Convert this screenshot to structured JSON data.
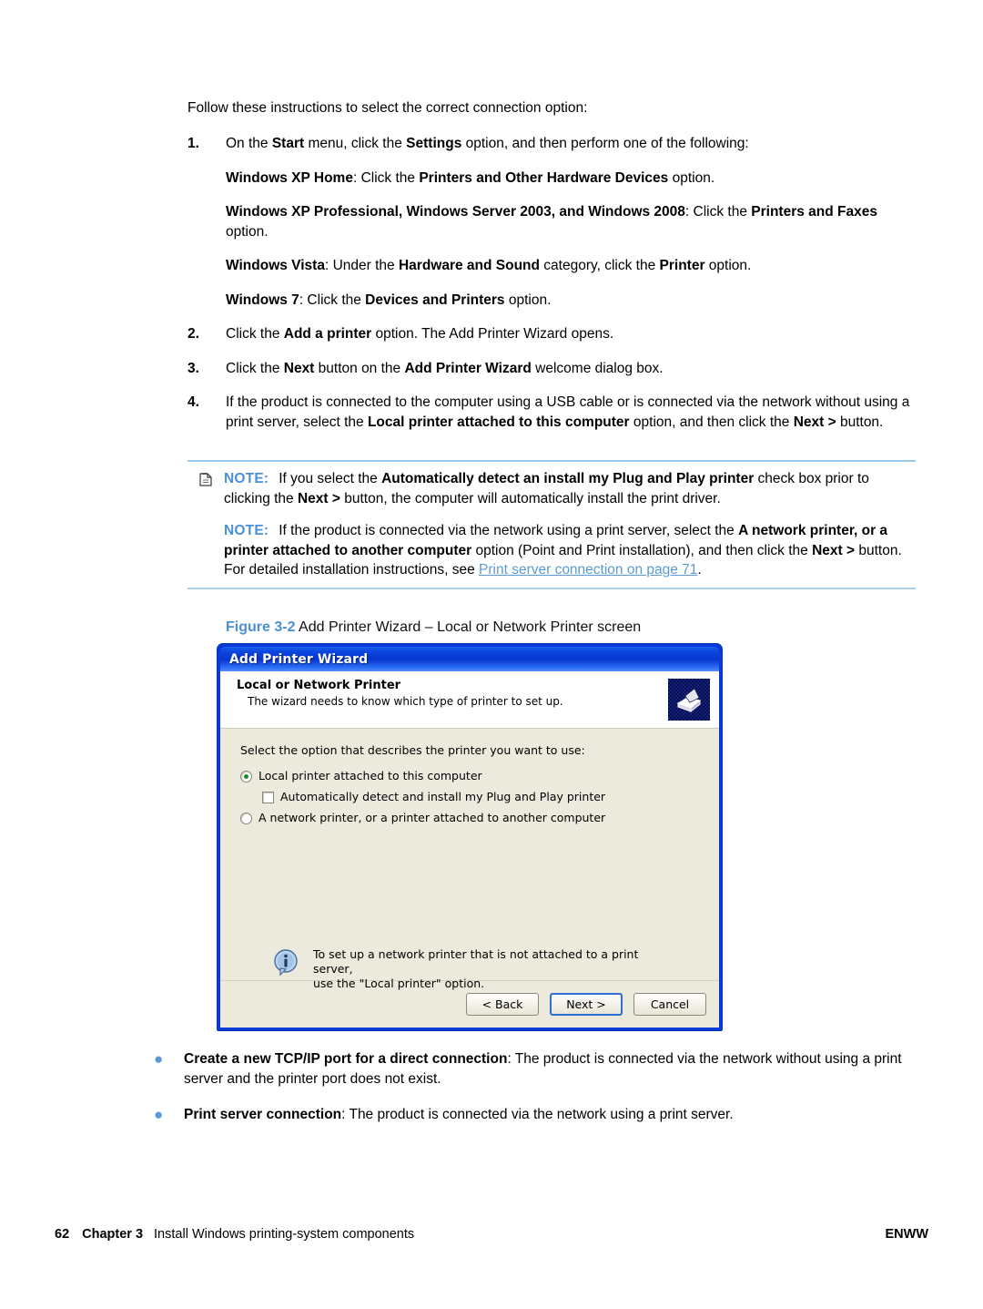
{
  "intro": {
    "text": "Follow these instructions to select the correct connection option:"
  },
  "steps": [
    {
      "num": "1.",
      "paragraphs": [
        {
          "segments": [
            {
              "t": "On the ",
              "b": false
            },
            {
              "t": "Start",
              "b": true
            },
            {
              "t": " menu, click the ",
              "b": false
            },
            {
              "t": "Settings",
              "b": true
            },
            {
              "t": " option, and then perform one of the following:",
              "b": false
            }
          ]
        },
        {
          "segments": [
            {
              "t": "Windows XP Home",
              "b": true
            },
            {
              "t": ": Click the ",
              "b": false
            },
            {
              "t": "Printers and Other Hardware Devices",
              "b": true
            },
            {
              "t": " option.",
              "b": false
            }
          ]
        },
        {
          "segments": [
            {
              "t": "Windows XP Professional, Windows Server 2003, and Windows 2008",
              "b": true
            },
            {
              "t": ": Click the ",
              "b": false
            },
            {
              "t": "Printers and Faxes",
              "b": true
            },
            {
              "t": " option.",
              "b": false
            }
          ]
        },
        {
          "segments": [
            {
              "t": "Windows Vista",
              "b": true
            },
            {
              "t": ": Under the ",
              "b": false
            },
            {
              "t": "Hardware and Sound",
              "b": true
            },
            {
              "t": " category, click the ",
              "b": false
            },
            {
              "t": "Printer",
              "b": true
            },
            {
              "t": " option.",
              "b": false
            }
          ]
        },
        {
          "segments": [
            {
              "t": "Windows 7",
              "b": true
            },
            {
              "t": ": Click the ",
              "b": false
            },
            {
              "t": "Devices and Printers",
              "b": true
            },
            {
              "t": " option.",
              "b": false
            }
          ]
        }
      ]
    },
    {
      "num": "2.",
      "paragraphs": [
        {
          "segments": [
            {
              "t": "Click the ",
              "b": false
            },
            {
              "t": "Add a printer",
              "b": true
            },
            {
              "t": " option. The Add Printer Wizard opens.",
              "b": false
            }
          ]
        }
      ]
    },
    {
      "num": "3.",
      "paragraphs": [
        {
          "segments": [
            {
              "t": "Click the ",
              "b": false
            },
            {
              "t": "Next",
              "b": true
            },
            {
              "t": " button on the ",
              "b": false
            },
            {
              "t": "Add Printer Wizard",
              "b": true
            },
            {
              "t": " welcome dialog box.",
              "b": false
            }
          ]
        }
      ]
    },
    {
      "num": "4.",
      "paragraphs": [
        {
          "segments": [
            {
              "t": "If the product is connected to the computer using a USB cable or is connected via the network without using a print server, select the ",
              "b": false
            },
            {
              "t": "Local printer attached to this computer",
              "b": true
            },
            {
              "t": " option, and then click the ",
              "b": false
            },
            {
              "t": "Next >",
              "b": true
            },
            {
              "t": " button.",
              "b": false
            }
          ]
        }
      ]
    }
  ],
  "notes": {
    "icon_name": "note-pencil-icon",
    "label": "NOTE:",
    "items": [
      {
        "segments": [
          {
            "t": "If you select the ",
            "b": false
          },
          {
            "t": "Automatically detect an install my Plug and Play printer",
            "b": true
          },
          {
            "t": " check box prior to clicking the ",
            "b": false
          },
          {
            "t": "Next >",
            "b": true
          },
          {
            "t": " button, the computer will automatically install the print driver.",
            "b": false
          }
        ]
      },
      {
        "segments": [
          {
            "t": "If the product is connected via the network using a print server, select the ",
            "b": false
          },
          {
            "t": "A network printer, or a printer attached to another computer",
            "b": true
          },
          {
            "t": " option (Point and Print installation), and then click the ",
            "b": false
          },
          {
            "t": "Next >",
            "b": true
          },
          {
            "t": " button. For detailed installation instructions, see ",
            "b": false
          },
          {
            "t": "Print server connection on page 71",
            "b": false,
            "link": true
          },
          {
            "t": ".",
            "b": false
          }
        ]
      }
    ]
  },
  "figure": {
    "label": "Figure 3-2",
    "title": "Add Printer Wizard – Local or Network Printer screen"
  },
  "dialog": {
    "title": "Add Printer Wizard",
    "header_title": "Local or Network Printer",
    "header_subtitle": "The wizard needs to know which type of printer to set up.",
    "printer_icon_name": "printer-icon",
    "prompt": "Select the option that describes the printer you want to use:",
    "options": [
      {
        "type": "radio",
        "checked": true,
        "label": "Local printer attached to this computer"
      },
      {
        "type": "checkbox",
        "checked": false,
        "label": "Automatically detect and install my Plug and Play printer"
      },
      {
        "type": "radio",
        "checked": false,
        "label": "A network printer, or a printer attached to another computer"
      }
    ],
    "info": {
      "icon_name": "info-icon",
      "line1": "To set up a network printer that is not attached to a print server,",
      "line2": "use the \"Local printer\" option."
    },
    "buttons": {
      "back": "< Back",
      "next": "Next >",
      "cancel": "Cancel"
    }
  },
  "bullets": [
    {
      "segments": [
        {
          "t": "Create a new TCP/IP port for a direct connection",
          "b": true
        },
        {
          "t": ": The product is connected via the network without using a print server and the printer port does not exist.",
          "b": false
        }
      ]
    },
    {
      "segments": [
        {
          "t": "Print server connection",
          "b": true
        },
        {
          "t": ": The product is connected via the network using a print server.",
          "b": false
        }
      ]
    }
  ],
  "footer": {
    "page": "62",
    "chapter": "Chapter 3",
    "title": "Install Windows printing-system components",
    "right": "ENWW"
  },
  "colors": {
    "accent_blue": "#4a90d9",
    "link_blue": "#5b9bd5",
    "rule_blue": "#9cc9ea",
    "dialog_border": "#0a3bd6",
    "dialog_body": "#ece9dd"
  }
}
